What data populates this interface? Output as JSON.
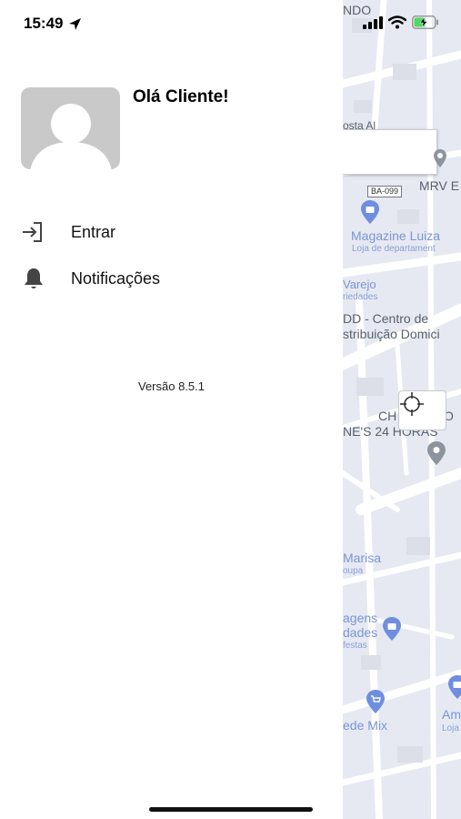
{
  "status_bar": {
    "time": "15:49"
  },
  "drawer": {
    "greeting": "Olá Cliente!",
    "menu": [
      {
        "label": "Entrar",
        "icon": "login-icon"
      },
      {
        "label": "Notificações",
        "icon": "bell-icon"
      }
    ],
    "version": "Versão 8.5.1"
  },
  "map": {
    "labels": {
      "top_fragment": "NDO",
      "street_fragment": "osta Al",
      "mrv": "MRV E",
      "route_badge": "BA-099",
      "magazine_luiza": "Magazine Luiza",
      "magazine_luiza_sub": "Loja de departament",
      "varejo": "Varejo",
      "varejo_sub": "riedades",
      "cdd_line1": "DD - Centro de",
      "cdd_line2": "stribuição Domici",
      "ch_fragment": "CH",
      "ch_fragment2": "O",
      "nes_24h": "NE'S 24 HORAS",
      "marisa": "Marisa",
      "marisa_sub": "oupa",
      "agens": "agens",
      "idades": "dades",
      "festas": "festas",
      "am": "Am",
      "loj": "Loja",
      "rede_mix": "ede Mix"
    }
  }
}
